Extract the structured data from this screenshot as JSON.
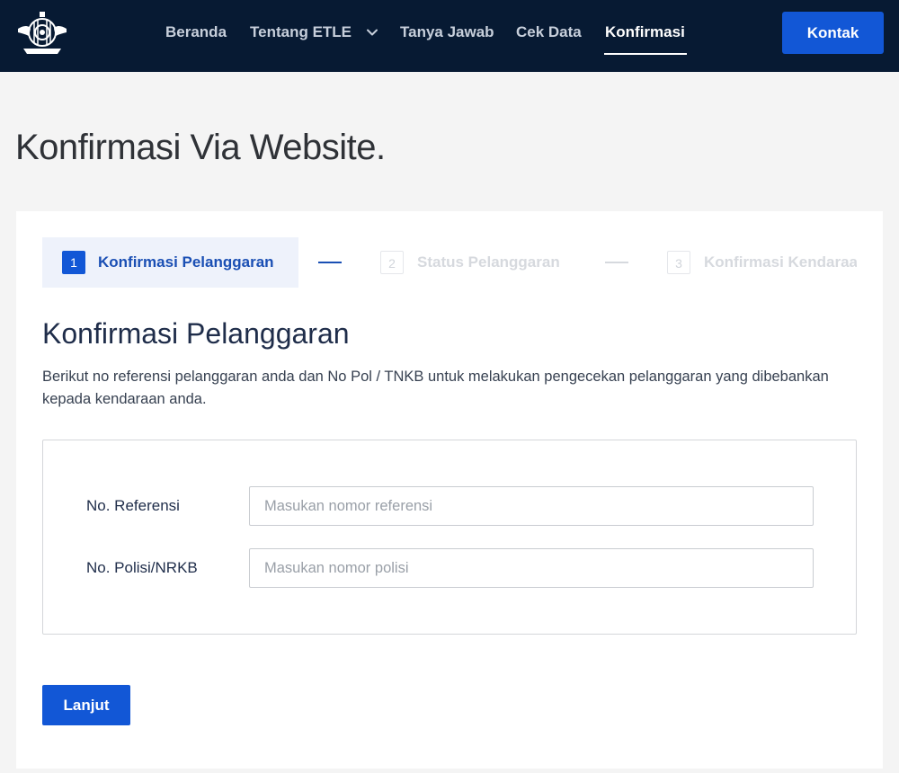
{
  "nav": {
    "items": [
      {
        "label": "Beranda"
      },
      {
        "label": "Tentang ETLE"
      },
      {
        "label": "Tanya Jawab"
      },
      {
        "label": "Cek Data"
      },
      {
        "label": "Konfirmasi"
      }
    ],
    "active": "Konfirmasi",
    "contact_label": "Kontak"
  },
  "page": {
    "title": "Konfirmasi Via Website."
  },
  "stepper": {
    "steps": [
      {
        "number": "1",
        "label": "Konfirmasi Pelanggaran",
        "state": "active"
      },
      {
        "number": "2",
        "label": "Status Pelanggaran",
        "state": "inactive"
      },
      {
        "number": "3",
        "label": "Konfirmasi Kendaraan",
        "state": "inactive"
      }
    ]
  },
  "section": {
    "title": "Konfirmasi Pelanggaran",
    "description": "Berikut no referensi pelanggaran anda dan No Pol / TNKB untuk melakukan pengecekan pelanggaran yang dibebankan kepada kendaraan anda."
  },
  "form": {
    "reference": {
      "label": "No. Referensi",
      "placeholder": "Masukan nomor referensi",
      "value": ""
    },
    "police": {
      "label": "No. Polisi/NRKB",
      "placeholder": "Masukan nomor polisi",
      "value": ""
    },
    "submit_label": "Lanjut"
  },
  "colors": {
    "navbar_bg": "#071a33",
    "primary": "#1257d6",
    "active_step_bg": "#eef2fb",
    "page_bg": "#f4f4f4"
  }
}
